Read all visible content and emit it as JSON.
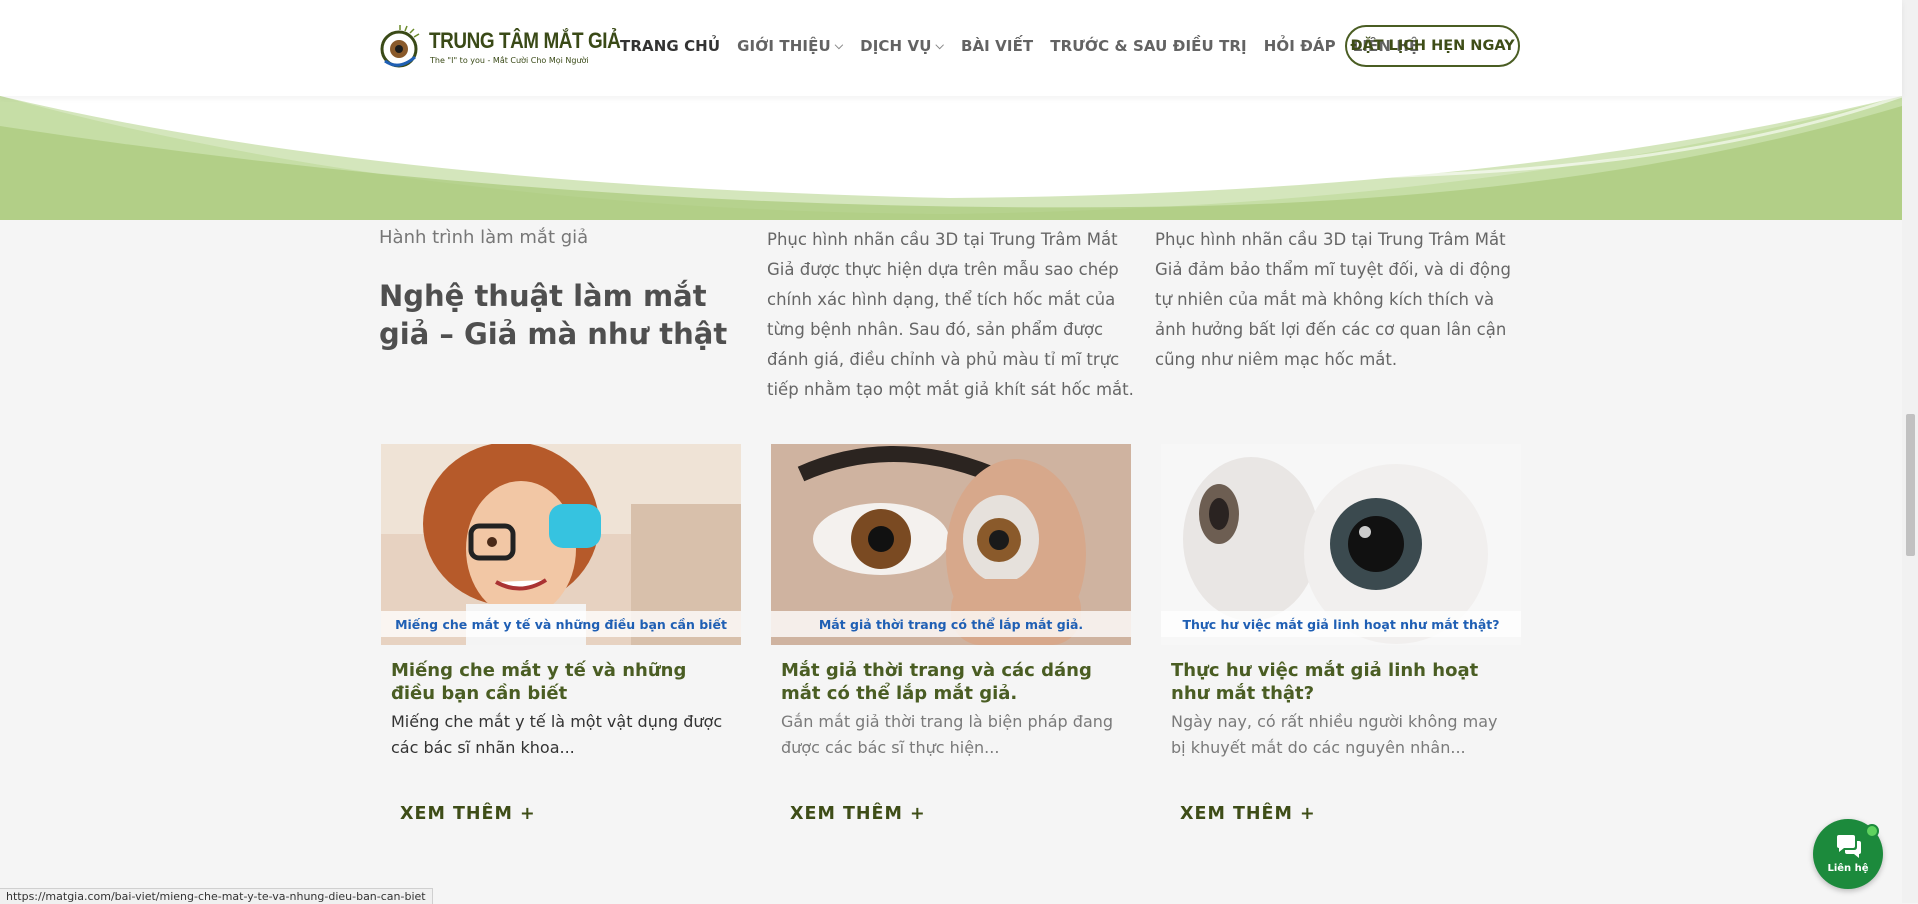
{
  "header": {
    "logo_name": "TRUNG TÂM MẮT GIẢ",
    "logo_tagline": "The \"I\" to you - Mắt Cười Cho Mọi Người",
    "nav": [
      {
        "label": "TRANG CHỦ"
      },
      {
        "label": "GIỚI THIỆU"
      },
      {
        "label": "DỊCH VỤ"
      },
      {
        "label": "BÀI VIẾT"
      },
      {
        "label": "TRƯỚC & SAU ĐIỀU TRỊ"
      },
      {
        "label": "HỎI ĐÁP"
      },
      {
        "label": "LIÊN HỆ"
      }
    ],
    "cta_label": "ĐẶT LỊCH HẸN NGAY"
  },
  "intro": {
    "eyebrow": "Hành trình làm mắt giả",
    "title": "Nghệ thuật làm mắt giả – Giả mà như thật",
    "col1": "Phục hình nhãn cầu 3D tại Trung Trâm Mắt Giả được thực hiện dựa trên mẫu sao chép chính xác hình dạng, thể tích hốc mắt của từng bệnh nhân. Sau đó, sản phẩm được đánh giá, điều chỉnh và phủ màu tỉ mĩ trực tiếp nhằm tạo một mắt giả khít sát hốc mắt.",
    "col2": "Phục hình nhãn cầu 3D tại Trung Trâm Mắt Giả đảm bảo thẩm mĩ tuyệt đối, và di động tự nhiên của mắt mà không kích thích và ảnh hưởng bất lợi đến các cơ quan lân cận cũng như niêm mạc hốc mắt."
  },
  "posts": [
    {
      "caption": "Miếng che mắt y tế và những điều bạn cần biết",
      "title": "Miếng che mắt y tế và những điều bạn cần biết",
      "excerpt": "Miếng che mắt y tế là một vật dụng được các bác sĩ nhãn khoa...",
      "more": "XEM THÊM +"
    },
    {
      "caption": "Mắt giả thời trang có thể lắp mắt giả.",
      "title": "Mắt giả thời trang và các dáng mắt có thể lắp mắt giả.",
      "excerpt": "Gắn mắt giả thời trang là biện pháp đang được các bác sĩ thực hiện...",
      "more": "XEM THÊM +"
    },
    {
      "caption": "Thực hư việc mắt giả linh hoạt như mắt thật?",
      "title": "Thực hư việc mắt giả linh hoạt như mắt thật?",
      "excerpt": "Ngày nay, có rất nhiều người không may bị khuyết mắt do các nguyên nhân...",
      "more": "XEM THÊM +"
    }
  ],
  "status_url": "https://matgia.com/bai-viet/mieng-che-mat-y-te-va-nhung-dieu-ban-can-biet",
  "chat_label": "Liên hệ",
  "colors": {
    "brand_green": "#4a5d23",
    "wave_green": "#a9c97a",
    "chat_green": "#1c8a3c",
    "caption_blue": "#1f5fb4"
  }
}
